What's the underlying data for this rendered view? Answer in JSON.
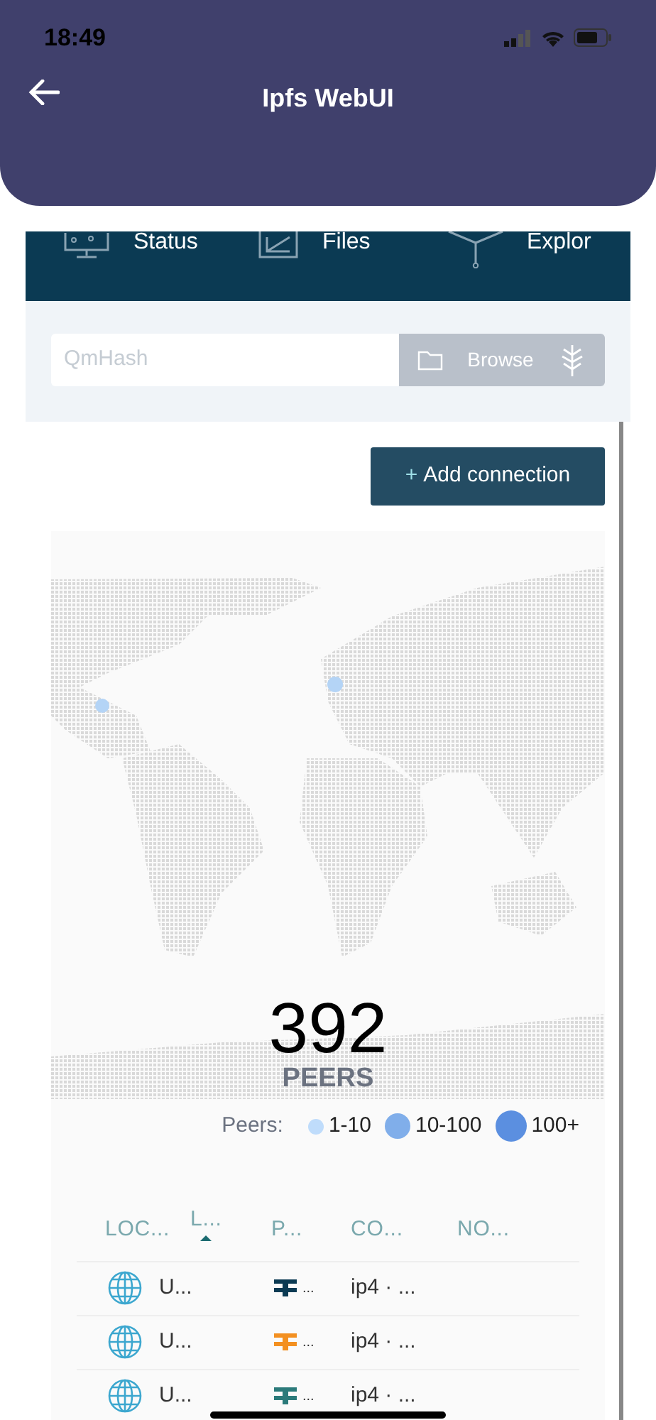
{
  "status_bar": {
    "time": "18:49"
  },
  "header": {
    "title": "Ipfs WebUI"
  },
  "tabs": [
    {
      "label": "Status",
      "kind": "status"
    },
    {
      "label": "Files",
      "kind": "files"
    },
    {
      "label": "Explor",
      "kind": "explore"
    }
  ],
  "search": {
    "placeholder": "QmHash",
    "browse_button": "Browse"
  },
  "add_connection": {
    "icon": "+",
    "label": "Add connection"
  },
  "peers": {
    "count": "392",
    "label": "PEERS"
  },
  "legend": {
    "label": "Peers:",
    "items": [
      {
        "label": "1-10",
        "color": "#bfdcfb",
        "kind": "small"
      },
      {
        "label": "10-100",
        "color": "#80aeea",
        "kind": "medium"
      },
      {
        "label": "100+",
        "color": "#5b8fe0",
        "kind": "large"
      }
    ]
  },
  "table": {
    "columns": [
      {
        "label": "LOC...",
        "sorted": false
      },
      {
        "label": "L...",
        "sorted": true
      },
      {
        "label": "P...",
        "sorted": false
      },
      {
        "label": "CO...",
        "sorted": false
      },
      {
        "label": "NO...",
        "sorted": false
      }
    ],
    "rows": [
      {
        "location": "U...",
        "color": "#0b3a53",
        "peer": "...",
        "connection": "ip4 · ..."
      },
      {
        "location": "U...",
        "color": "#f39021",
        "peer": "...",
        "connection": "ip4 · ..."
      },
      {
        "location": "U...",
        "color": "#2b7a7a",
        "peer": "...",
        "connection": "ip4 · ..."
      }
    ]
  }
}
